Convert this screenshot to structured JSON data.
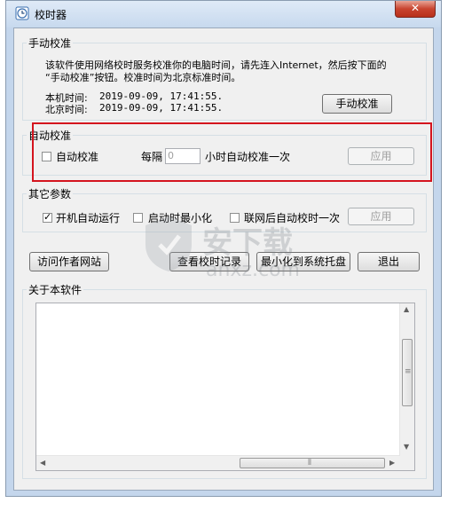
{
  "window": {
    "title": "校时器",
    "close_label": "✕",
    "icon": "clock-app-icon"
  },
  "manual": {
    "group_title": "手动校准",
    "description_line1": "该软件使用网络校时服务校准你的电脑时间，请先连入Internet，然后按下面的",
    "description_line2": "“手动校准”按钮。校准时间为北京标准时间。",
    "local_time_label": "本机时间:",
    "local_time_value": "2019-09-09, 17:41:55.",
    "beijing_time_label": "北京时间:",
    "beijing_time_value": "2019-09-09, 17:41:55.",
    "button_label": "手动校准"
  },
  "auto": {
    "group_title": "自动校准",
    "checkbox_label": "自动校准",
    "checked": false,
    "interval_prefix": "每隔",
    "interval_value": "0",
    "interval_suffix": "小时自动校准一次",
    "apply_label": "应用",
    "highlight_color": "#d4141e"
  },
  "other": {
    "group_title": "其它参数",
    "opt1_label": "开机自动运行",
    "opt1_checked": true,
    "opt2_label": "启动时最小化",
    "opt2_checked": false,
    "opt3_label": "联网后自动校时一次",
    "opt3_checked": false,
    "apply_label": "应用"
  },
  "actions": {
    "visit_author": "访问作者网站",
    "view_log": "查看校时记录",
    "minimize_tray": "最小化到系统托盘",
    "exit": "退出"
  },
  "about": {
    "group_title": "关于本软件",
    "content": ""
  },
  "watermark": {
    "brand": "安下载",
    "domain": "anxz.com"
  }
}
